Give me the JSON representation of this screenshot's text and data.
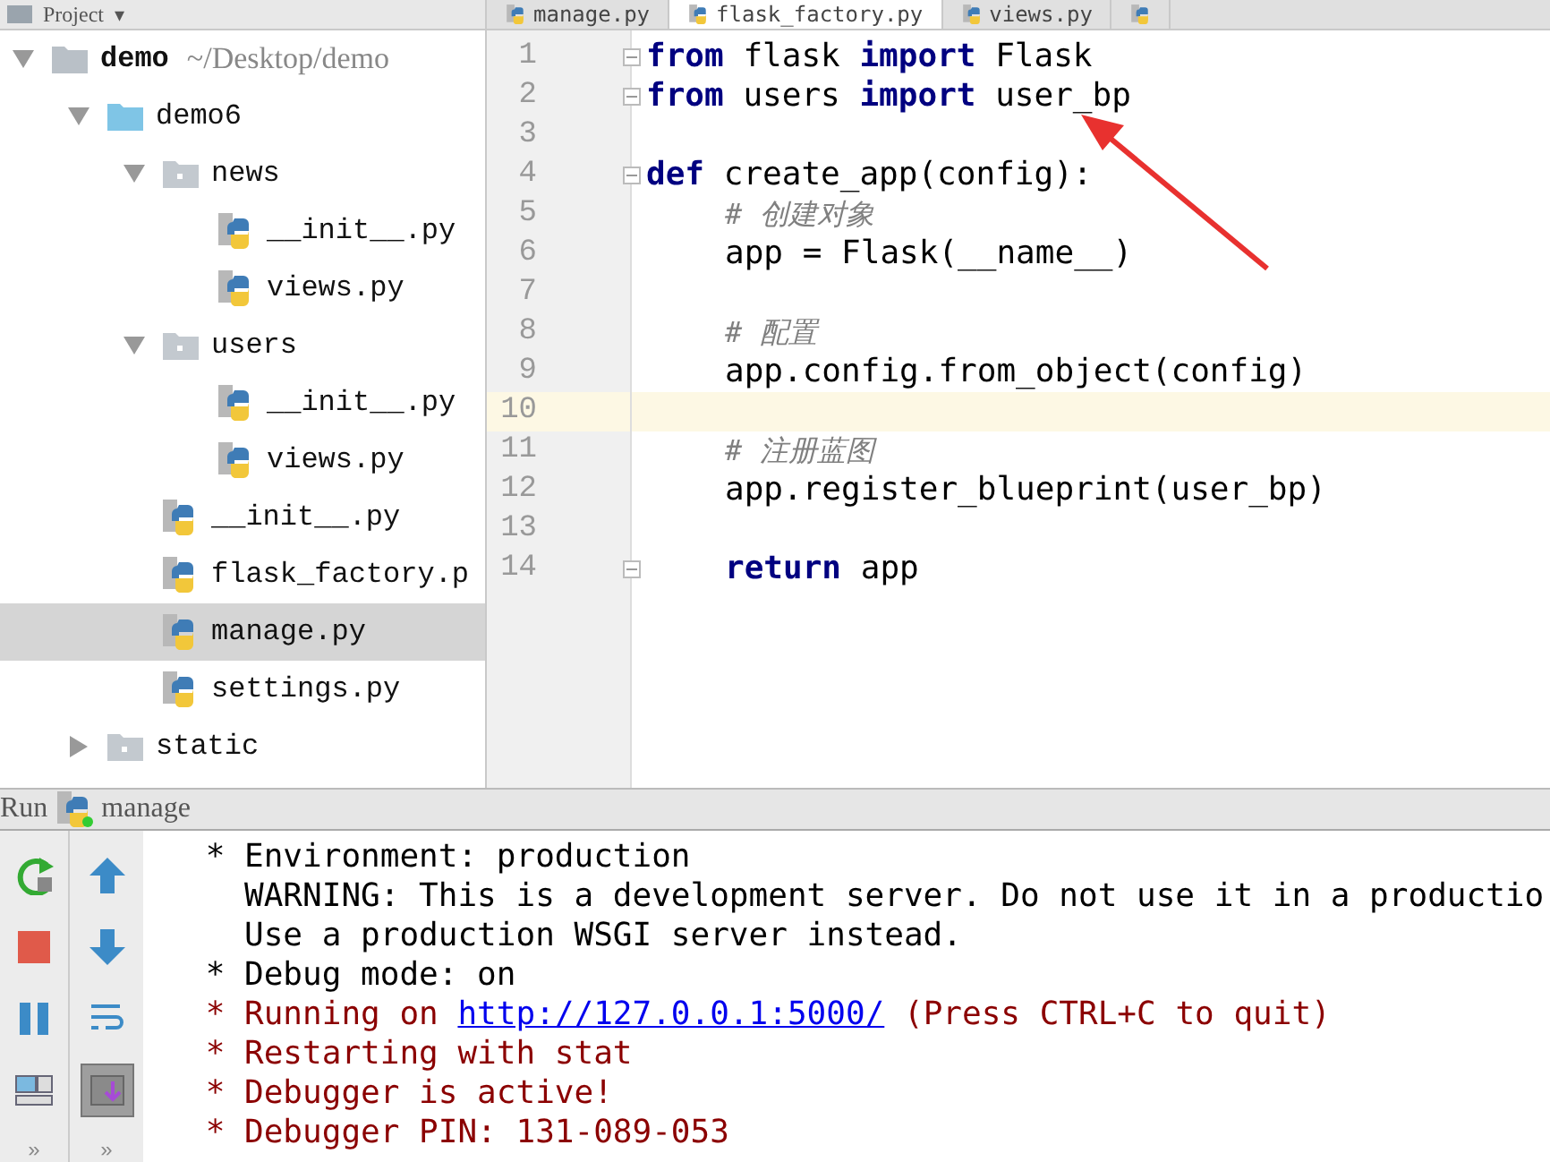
{
  "project_bar": {
    "title": "Project",
    "dropdown": "▾"
  },
  "editor_tabs": [
    {
      "label": "manage.py",
      "selected": false
    },
    {
      "label": "flask_factory.py",
      "selected": true
    },
    {
      "label": "views.py",
      "selected": false
    },
    {
      "selected": false
    }
  ],
  "tree": [
    {
      "kind": "root",
      "label": "demo",
      "path": "~/Desktop/demo",
      "expanded": true,
      "selected": false,
      "children": [
        {
          "kind": "package",
          "label": "demo6",
          "expanded": true,
          "selected": false,
          "children": [
            {
              "kind": "folder",
              "label": "news",
              "expanded": true,
              "selected": false,
              "children": [
                {
                  "kind": "file",
                  "label": "__init__.py",
                  "selected": false
                },
                {
                  "kind": "file",
                  "label": "views.py",
                  "selected": false
                }
              ]
            },
            {
              "kind": "folder",
              "label": "users",
              "expanded": true,
              "selected": false,
              "children": [
                {
                  "kind": "file",
                  "label": "__init__.py",
                  "selected": false
                },
                {
                  "kind": "file",
                  "label": "views.py",
                  "selected": false
                }
              ]
            },
            {
              "kind": "file",
              "label": "__init__.py",
              "selected": false
            },
            {
              "kind": "file",
              "label": "flask_factory.p",
              "selected": false
            },
            {
              "kind": "file",
              "label": "manage.py",
              "selected": true
            },
            {
              "kind": "file",
              "label": "settings.py",
              "selected": false
            }
          ]
        },
        {
          "kind": "folder",
          "label": "static",
          "expanded": false,
          "selected": false
        }
      ]
    }
  ],
  "code_lines": [
    {
      "number": "1",
      "fold": true,
      "current": false,
      "indented": false,
      "tokens": [
        {
          "kind": "keyword",
          "text": "from"
        },
        {
          "kind": "plain",
          "text": " flask "
        },
        {
          "kind": "keyword",
          "text": "import"
        },
        {
          "kind": "plain",
          "text": " Flask"
        }
      ]
    },
    {
      "number": "2",
      "fold": true,
      "current": false,
      "indented": false,
      "tokens": [
        {
          "kind": "keyword",
          "text": "from"
        },
        {
          "kind": "plain",
          "text": " users "
        },
        {
          "kind": "keyword",
          "text": "import"
        },
        {
          "kind": "plain",
          "text": " user_bp"
        }
      ]
    },
    {
      "number": "3",
      "fold": false,
      "current": false
    },
    {
      "number": "4",
      "fold": true,
      "current": false,
      "indented": false,
      "tokens": [
        {
          "kind": "keyword",
          "text": "def"
        },
        {
          "kind": "plain",
          "text": " create_app(config):"
        }
      ]
    },
    {
      "number": "5",
      "fold": false,
      "current": false,
      "indented": true,
      "tokens": [
        {
          "kind": "comment",
          "text": "# 创建对象"
        }
      ]
    },
    {
      "number": "6",
      "fold": false,
      "current": false,
      "indented": true,
      "tokens": [
        {
          "kind": "plain",
          "text": "app = Flask(__name__)"
        }
      ]
    },
    {
      "number": "7",
      "fold": false,
      "current": false
    },
    {
      "number": "8",
      "fold": false,
      "current": false,
      "indented": true,
      "tokens": [
        {
          "kind": "comment",
          "text": "# 配置"
        }
      ]
    },
    {
      "number": "9",
      "fold": false,
      "current": false,
      "indented": true,
      "tokens": [
        {
          "kind": "plain",
          "text": "app.config.from_object(config)"
        }
      ]
    },
    {
      "number": "10",
      "fold": false,
      "current": true
    },
    {
      "number": "11",
      "fold": false,
      "current": false,
      "indented": true,
      "tokens": [
        {
          "kind": "comment",
          "text": "# 注册蓝图"
        }
      ]
    },
    {
      "number": "12",
      "fold": false,
      "current": false,
      "indented": true,
      "tokens": [
        {
          "kind": "plain",
          "text": "app.register_blueprint(user_bp)"
        }
      ]
    },
    {
      "number": "13",
      "fold": false,
      "current": false
    },
    {
      "number": "14",
      "fold": true,
      "current": false,
      "indented": true,
      "tokens": [
        {
          "kind": "keyword",
          "text": "return"
        },
        {
          "kind": "plain",
          "text": " app"
        }
      ]
    }
  ],
  "run_panel": {
    "title": "Run",
    "config": "manage",
    "left_tools": [
      {
        "kind": "rerun",
        "on": false
      },
      {
        "kind": "stop",
        "on": false
      },
      {
        "kind": "pause",
        "on": false
      },
      {
        "kind": "layout",
        "on": false
      }
    ],
    "right_tools": [
      {
        "kind": "up",
        "on": false
      },
      {
        "kind": "down",
        "on": false
      },
      {
        "kind": "wrap",
        "on": false
      },
      {
        "kind": "scroll_end",
        "on": true
      }
    ],
    "more": [
      "»",
      "»"
    ],
    "console": [
      [
        {
          "kind": "plain",
          "text": " * Environment: production"
        }
      ],
      [
        {
          "kind": "plain",
          "text": "   WARNING: This is a development server. Do not use it in a productio"
        }
      ],
      [
        {
          "kind": "plain",
          "text": "   Use a production WSGI server instead."
        }
      ],
      [
        {
          "kind": "plain",
          "text": " * Debug mode: on"
        }
      ],
      [
        {
          "kind": "error",
          "text": " * Running on "
        },
        {
          "kind": "link",
          "text": "http://127.0.0.1:5000/"
        },
        {
          "kind": "error",
          "text": " (Press CTRL+C to quit)"
        }
      ],
      [
        {
          "kind": "error",
          "text": " * Restarting with stat"
        }
      ],
      [
        {
          "kind": "error",
          "text": " * Debugger is active!"
        }
      ],
      [
        {
          "kind": "error",
          "text": " * Debugger PIN: 131-089-053"
        }
      ]
    ]
  }
}
